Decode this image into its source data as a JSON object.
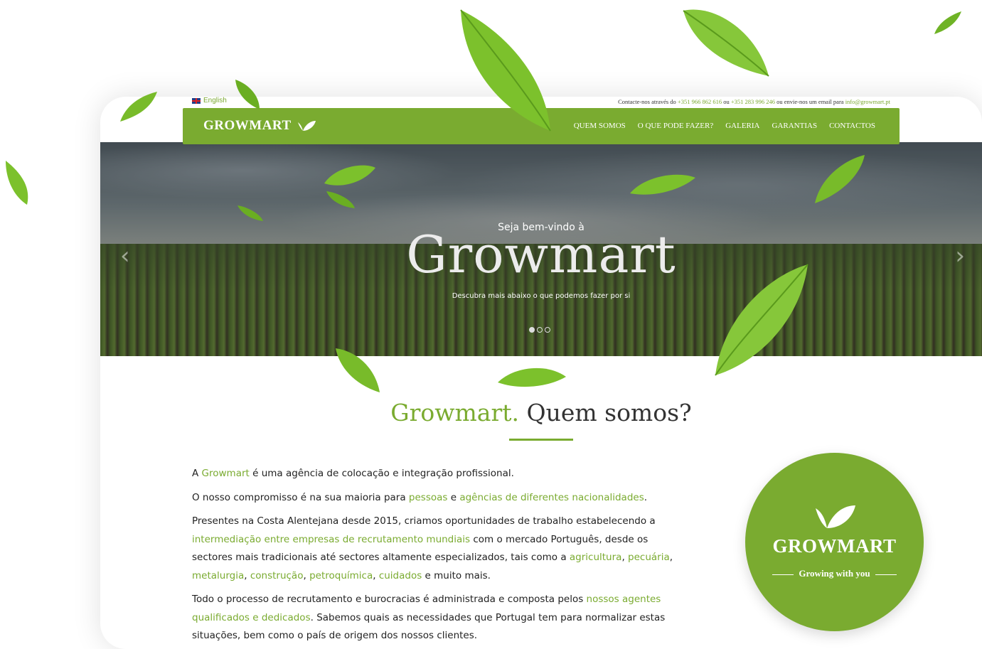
{
  "topbar": {
    "language": "English",
    "contact_prefix": "Contacte-nos através do",
    "phone1": "+351 966 862 616",
    "contact_or": "ou",
    "phone2": "+351 283 996 246",
    "contact_email_text": "ou envie-nos um email para",
    "email": "info@growmart.pt"
  },
  "navbar": {
    "brand": "GROWMART",
    "items": [
      "QUEM SOMOS",
      "O QUE PODE FAZER?",
      "GALERIA",
      "GARANTIAS",
      "CONTACTOS"
    ]
  },
  "hero": {
    "pretitle": "Seja bem-vindo à",
    "title": "Growmart",
    "subtitle": "Descubra mais abaixo o que podemos fazer por si",
    "slides_total": 3,
    "active_slide": 1
  },
  "about": {
    "title_accent": "Growmart.",
    "title_rest": "Quem somos?",
    "p1_a": "A ",
    "p1_link": "Growmart",
    "p1_b": " é uma agência de colocação e integração profissional.",
    "p2_a": "O nosso compromisso é na sua maioria para ",
    "p2_link1": "pessoas",
    "p2_b": " e ",
    "p2_link2": "agências de diferentes nacionalidades",
    "p2_c": ".",
    "p3_a": "Presentes na Costa Alentejana desde 2015, criamos oportunidades de trabalho estabelecendo a ",
    "p3_link1": "intermediação entre empresas de recrutamento mundiais",
    "p3_b": " com o mercado Português, desde os sectores mais tradicionais até sectores altamente especializados, tais como a ",
    "p3_link2": "agricultura",
    "p3_sep1": ", ",
    "p3_link3": "pecuária",
    "p3_sep2": ", ",
    "p3_link4": "metalurgia",
    "p3_sep3": ", ",
    "p3_link5": "construção",
    "p3_sep4": ", ",
    "p3_link6": "petroquímica",
    "p3_sep5": ", ",
    "p3_link7": "cuidados",
    "p3_c": " e muito mais.",
    "p4_a": "Todo o processo de recrutamento e burocracias é administrada e composta pelos ",
    "p4_link": "nossos agentes qualificados e dedicados",
    "p4_b": ". Sabemos quais as necessidades que Portugal tem para normalizar estas situações, bem como o país de origem dos nossos clientes."
  },
  "badge": {
    "name": "GROWMART",
    "tagline": "Growing with you"
  },
  "colors": {
    "brand_green": "#7aab30",
    "text": "#222222"
  }
}
